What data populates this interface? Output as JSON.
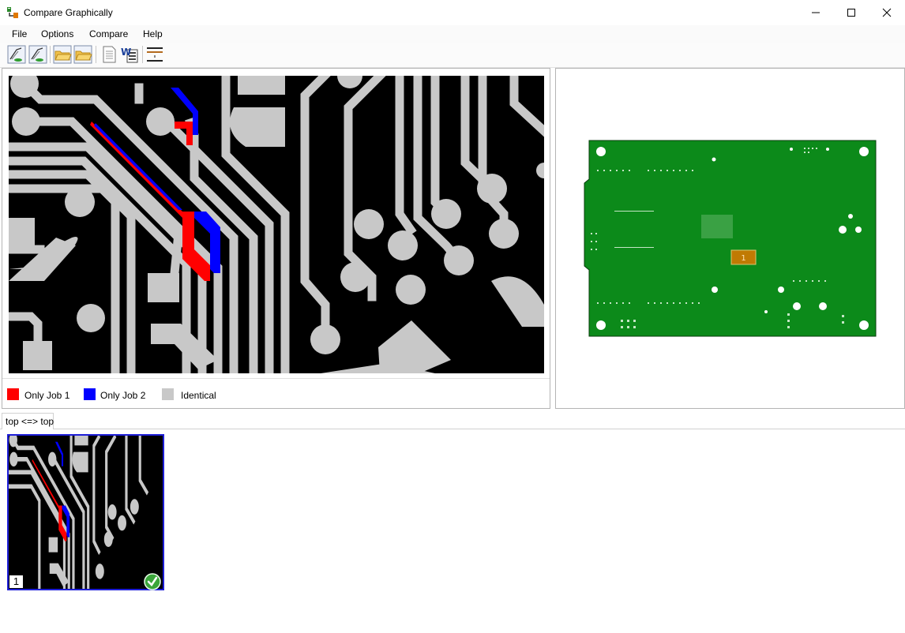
{
  "window": {
    "title": "Compare Graphically",
    "controls": [
      "minimize",
      "maximize",
      "close"
    ]
  },
  "menu": {
    "items": [
      "File",
      "Options",
      "Compare",
      "Help"
    ]
  },
  "toolbar": {
    "buttons": [
      {
        "name": "load-job-1",
        "icon": "pcb-load-icon"
      },
      {
        "name": "load-job-2",
        "icon": "pcb-load-icon"
      },
      {
        "name": "open-folder-1",
        "icon": "folder-icon"
      },
      {
        "name": "open-folder-2",
        "icon": "folder-icon"
      },
      {
        "name": "report",
        "icon": "document-icon"
      },
      {
        "name": "export-word",
        "icon": "word-export-icon"
      },
      {
        "name": "layer-settings",
        "icon": "layer-icon"
      }
    ]
  },
  "legend": {
    "items": [
      {
        "label": "Only Job 1",
        "color": "#ff0000"
      },
      {
        "label": "Only Job 2",
        "color": "#0000ff"
      },
      {
        "label": "Identical",
        "color": "#c8c8c8"
      }
    ]
  },
  "overview": {
    "board_color": "#0c8a1a",
    "marker_label": "1",
    "marker_color": "#e07800"
  },
  "tabs": [
    {
      "label": "top <=> top",
      "active": true
    }
  ],
  "thumbnails": [
    {
      "number": "1",
      "status": "checked"
    }
  ],
  "colors": {
    "only_job_1": "#ff0000",
    "only_job_2": "#0000ff",
    "identical": "#c8c8c8",
    "background": "#000000"
  }
}
